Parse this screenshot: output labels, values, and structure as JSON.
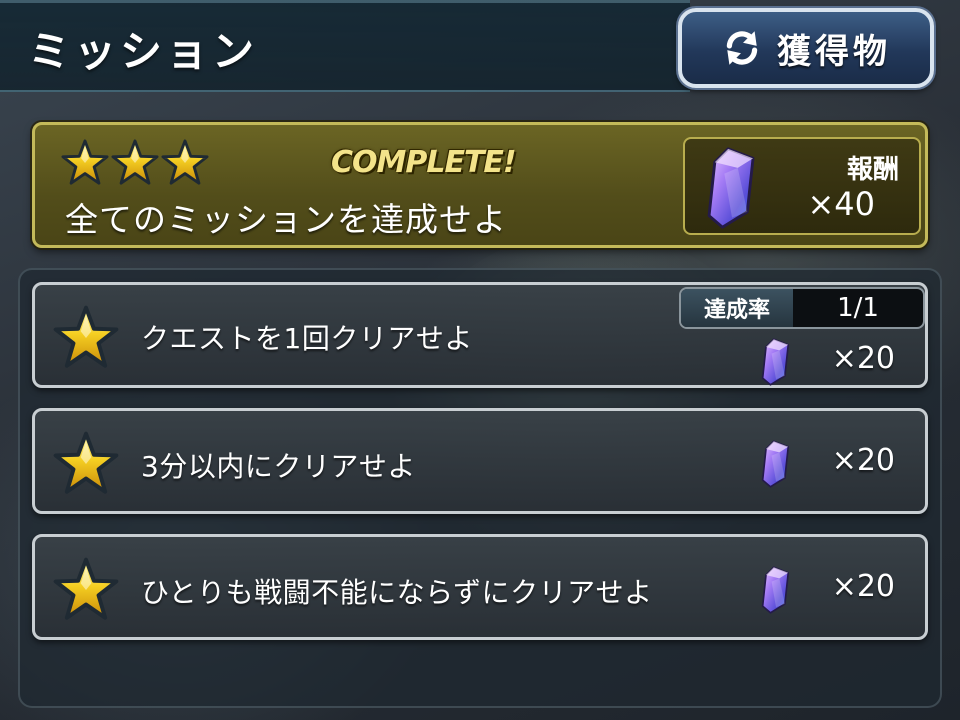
{
  "header": {
    "title": "ミッション",
    "loot_button_label": "獲得物",
    "loot_button_icon": "refresh-icon"
  },
  "complete_panel": {
    "stars": 3,
    "status": "COMPLETE!",
    "mission_text": "全てのミッションを達成せよ",
    "reward_label": "報酬",
    "reward_amount": "×40",
    "reward_icon": "purple-crystal-icon"
  },
  "missions": [
    {
      "text": "クエストを1回クリアせよ",
      "reward_amount": "×20",
      "progress_label": "達成率",
      "progress_value": "1/1"
    },
    {
      "text": "3分以内にクリアせよ",
      "reward_amount": "×20"
    },
    {
      "text": "ひとりも戦闘不能にならずにクリアせよ",
      "reward_amount": "×20"
    }
  ],
  "colors": {
    "star": "#f2c21a",
    "complete_panel": "#5a5520",
    "crystal": "#8a6cf0",
    "loot_button": "#2b4468"
  }
}
